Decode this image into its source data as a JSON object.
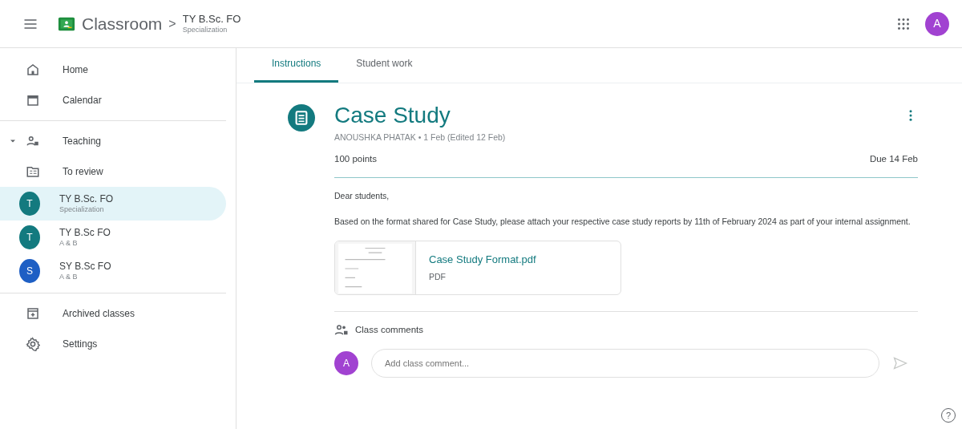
{
  "header": {
    "app": "Classroom",
    "separator": ">",
    "class_name": "TY B.Sc. FO",
    "class_section": "Specialization",
    "avatar": "A"
  },
  "sidebar": {
    "items": [
      {
        "kind": "home",
        "label": "Home",
        "selected": false
      },
      {
        "kind": "calendar",
        "label": "Calendar",
        "selected": false
      },
      {
        "kind": "teaching",
        "label": "Teaching",
        "selected": false,
        "expanded": true
      },
      {
        "kind": "review",
        "label": "To review",
        "selected": false
      },
      {
        "kind": "class",
        "label": "TY B.Sc. FO",
        "subtitle": "Specialization",
        "letter": "T",
        "color": "#137a7f",
        "selected": true
      },
      {
        "kind": "class",
        "label": "TY B.Sc FO",
        "subtitle": "A & B",
        "letter": "T",
        "color": "#137a7f",
        "selected": false
      },
      {
        "kind": "class",
        "label": "SY B.Sc FO",
        "subtitle": "A & B",
        "letter": "S",
        "color": "#1e5fc4",
        "selected": false
      },
      {
        "kind": "archive",
        "label": "Archived classes",
        "selected": false
      },
      {
        "kind": "settings",
        "label": "Settings",
        "selected": false
      }
    ]
  },
  "tabs": [
    {
      "label": "Instructions",
      "selected": true
    },
    {
      "label": "Student work",
      "selected": false
    }
  ],
  "assignment": {
    "title": "Case Study",
    "meta": "ANOUSHKA PHATAK • 1 Feb (Edited 12 Feb)",
    "points": "100 points",
    "due": "Due 14 Feb",
    "body": [
      "Dear students,",
      "Based on the format shared for Case Study, please attach your respective case study reports by 11th of February 2024 as part of your internal assignment."
    ],
    "attachment": {
      "name": "Case Study Format.pdf",
      "type": "PDF"
    }
  },
  "comments": {
    "heading": "Class comments",
    "avatar": "A",
    "placeholder": "Add class comment..."
  },
  "help": "?"
}
